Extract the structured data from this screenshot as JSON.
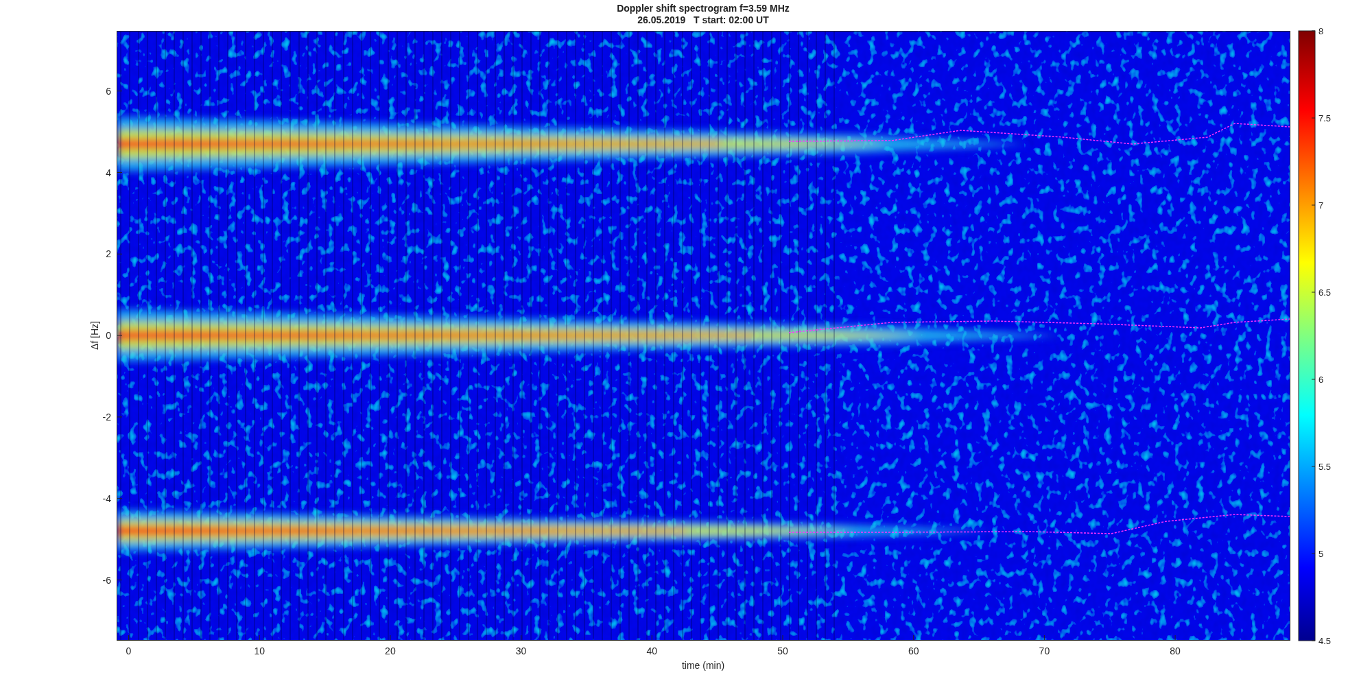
{
  "title": [
    "Doppler shift spectrogram f=3.59 MHz",
    "26.05.2019   T start: 02:00 UT"
  ],
  "xlabel": "time (min)",
  "ylabel": "Δf [Hz]",
  "xticks": [
    "0",
    "10",
    "20",
    "30",
    "40",
    "50",
    "60",
    "70",
    "80"
  ],
  "yticks": [
    "6",
    "4",
    "2",
    "0",
    "-2",
    "-4",
    "-6"
  ],
  "colorbar_ticks": [
    "8",
    "7.5",
    "7",
    "6.5",
    "6",
    "5.5",
    "5",
    "4.5"
  ]
}
